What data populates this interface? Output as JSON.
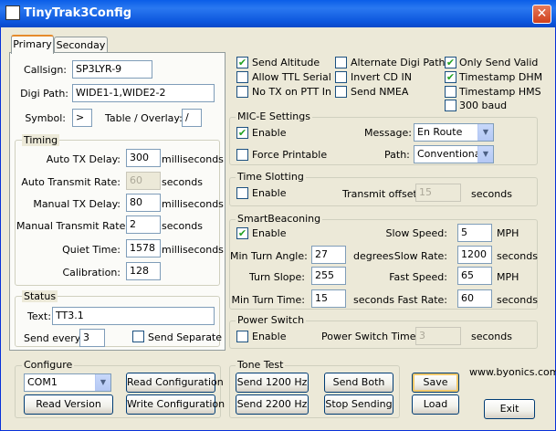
{
  "window": {
    "title": "TinyTrak3Config",
    "close_glyph": "✕"
  },
  "tabs": [
    {
      "label": "Primary"
    },
    {
      "label": "Seconday"
    }
  ],
  "primary": {
    "callsign_label": "Callsign:",
    "callsign_value": "SP3LYR-9",
    "digipath_label": "Digi Path:",
    "digipath_value": "WIDE1-1,WIDE2-2",
    "symbol_label": "Symbol:",
    "symbol_value": ">",
    "table_label": "Table / Overlay:",
    "table_value": "/"
  },
  "timing": {
    "title": "Timing",
    "auto_tx_label": "Auto TX Delay:",
    "auto_tx_value": "300",
    "auto_tx_unit": "milliseconds",
    "auto_rate_label": "Auto Transmit Rate:",
    "auto_rate_value": "60",
    "auto_rate_unit": "seconds",
    "manual_tx_label": "Manual TX Delay:",
    "manual_tx_value": "80",
    "manual_tx_unit": "milliseconds",
    "manual_rate_label": "Manual Transmit Rate:",
    "manual_rate_value": "2",
    "manual_rate_unit": "seconds",
    "quiet_label": "Quiet Time:",
    "quiet_value": "1578",
    "quiet_unit": "milliseconds",
    "calib_label": "Calibration:",
    "calib_value": "128"
  },
  "status": {
    "title": "Status",
    "text_label": "Text:",
    "text_value": "TT3.1",
    "send_every_label": "Send every:",
    "send_every_value": "3",
    "send_separate_label": "Send Separate"
  },
  "options": {
    "send_altitude": "Send Altitude",
    "allow_ttl": "Allow TTL Serial",
    "no_tx_ptt": "No TX on PTT In",
    "alt_digi": "Alternate Digi Paths",
    "invert_cd": "Invert CD IN",
    "send_nmea": "Send NMEA",
    "only_valid": "Only Send Valid",
    "ts_dhm": "Timestamp DHM",
    "ts_hms": "Timestamp HMS",
    "baud300": "300 baud"
  },
  "mice": {
    "title": "MIC-E Settings",
    "enable": "Enable",
    "force_printable": "Force Printable",
    "message_label": "Message:",
    "message_value": "En Route",
    "path_label": "Path:",
    "path_value": "Conventional"
  },
  "slotting": {
    "title": "Time Slotting",
    "enable": "Enable",
    "offset_label": "Transmit offset:",
    "offset_value": "15",
    "offset_unit": "seconds"
  },
  "smartbeaconing": {
    "title": "SmartBeaconing",
    "enable": "Enable",
    "slow_speed_label": "Slow Speed:",
    "slow_speed_value": "5",
    "slow_speed_unit": "MPH",
    "min_turn_angle_label": "Min Turn Angle:",
    "min_turn_angle_value": "27",
    "min_turn_angle_unit": "degrees",
    "slow_rate_label": "Slow Rate:",
    "slow_rate_value": "1200",
    "slow_rate_unit": "seconds",
    "turn_slope_label": "Turn Slope:",
    "turn_slope_value": "255",
    "fast_speed_label": "Fast Speed:",
    "fast_speed_value": "65",
    "fast_speed_unit": "MPH",
    "min_turn_time_label": "Min Turn Time:",
    "min_turn_time_value": "15",
    "min_turn_time_unit": "seconds",
    "fast_rate_label": "Fast Rate:",
    "fast_rate_value": "60",
    "fast_rate_unit": "seconds"
  },
  "power": {
    "title": "Power Switch",
    "enable": "Enable",
    "time_label": "Power Switch Time:",
    "time_value": "3",
    "time_unit": "seconds"
  },
  "configure": {
    "title": "Configure",
    "port_value": "COM1",
    "read_config": "Read Configuration",
    "read_version": "Read Version",
    "write_config": "Write Configuration"
  },
  "tone": {
    "title": "Tone Test",
    "send1200": "Send 1200 Hz",
    "send_both": "Send Both",
    "send2200": "Send 2200 Hz",
    "stop": "Stop Sending"
  },
  "actions": {
    "save": "Save",
    "load": "Load",
    "exit": "Exit",
    "website": "www.byonics.com"
  },
  "check_glyph": "✔",
  "arrow_glyph": "▼"
}
